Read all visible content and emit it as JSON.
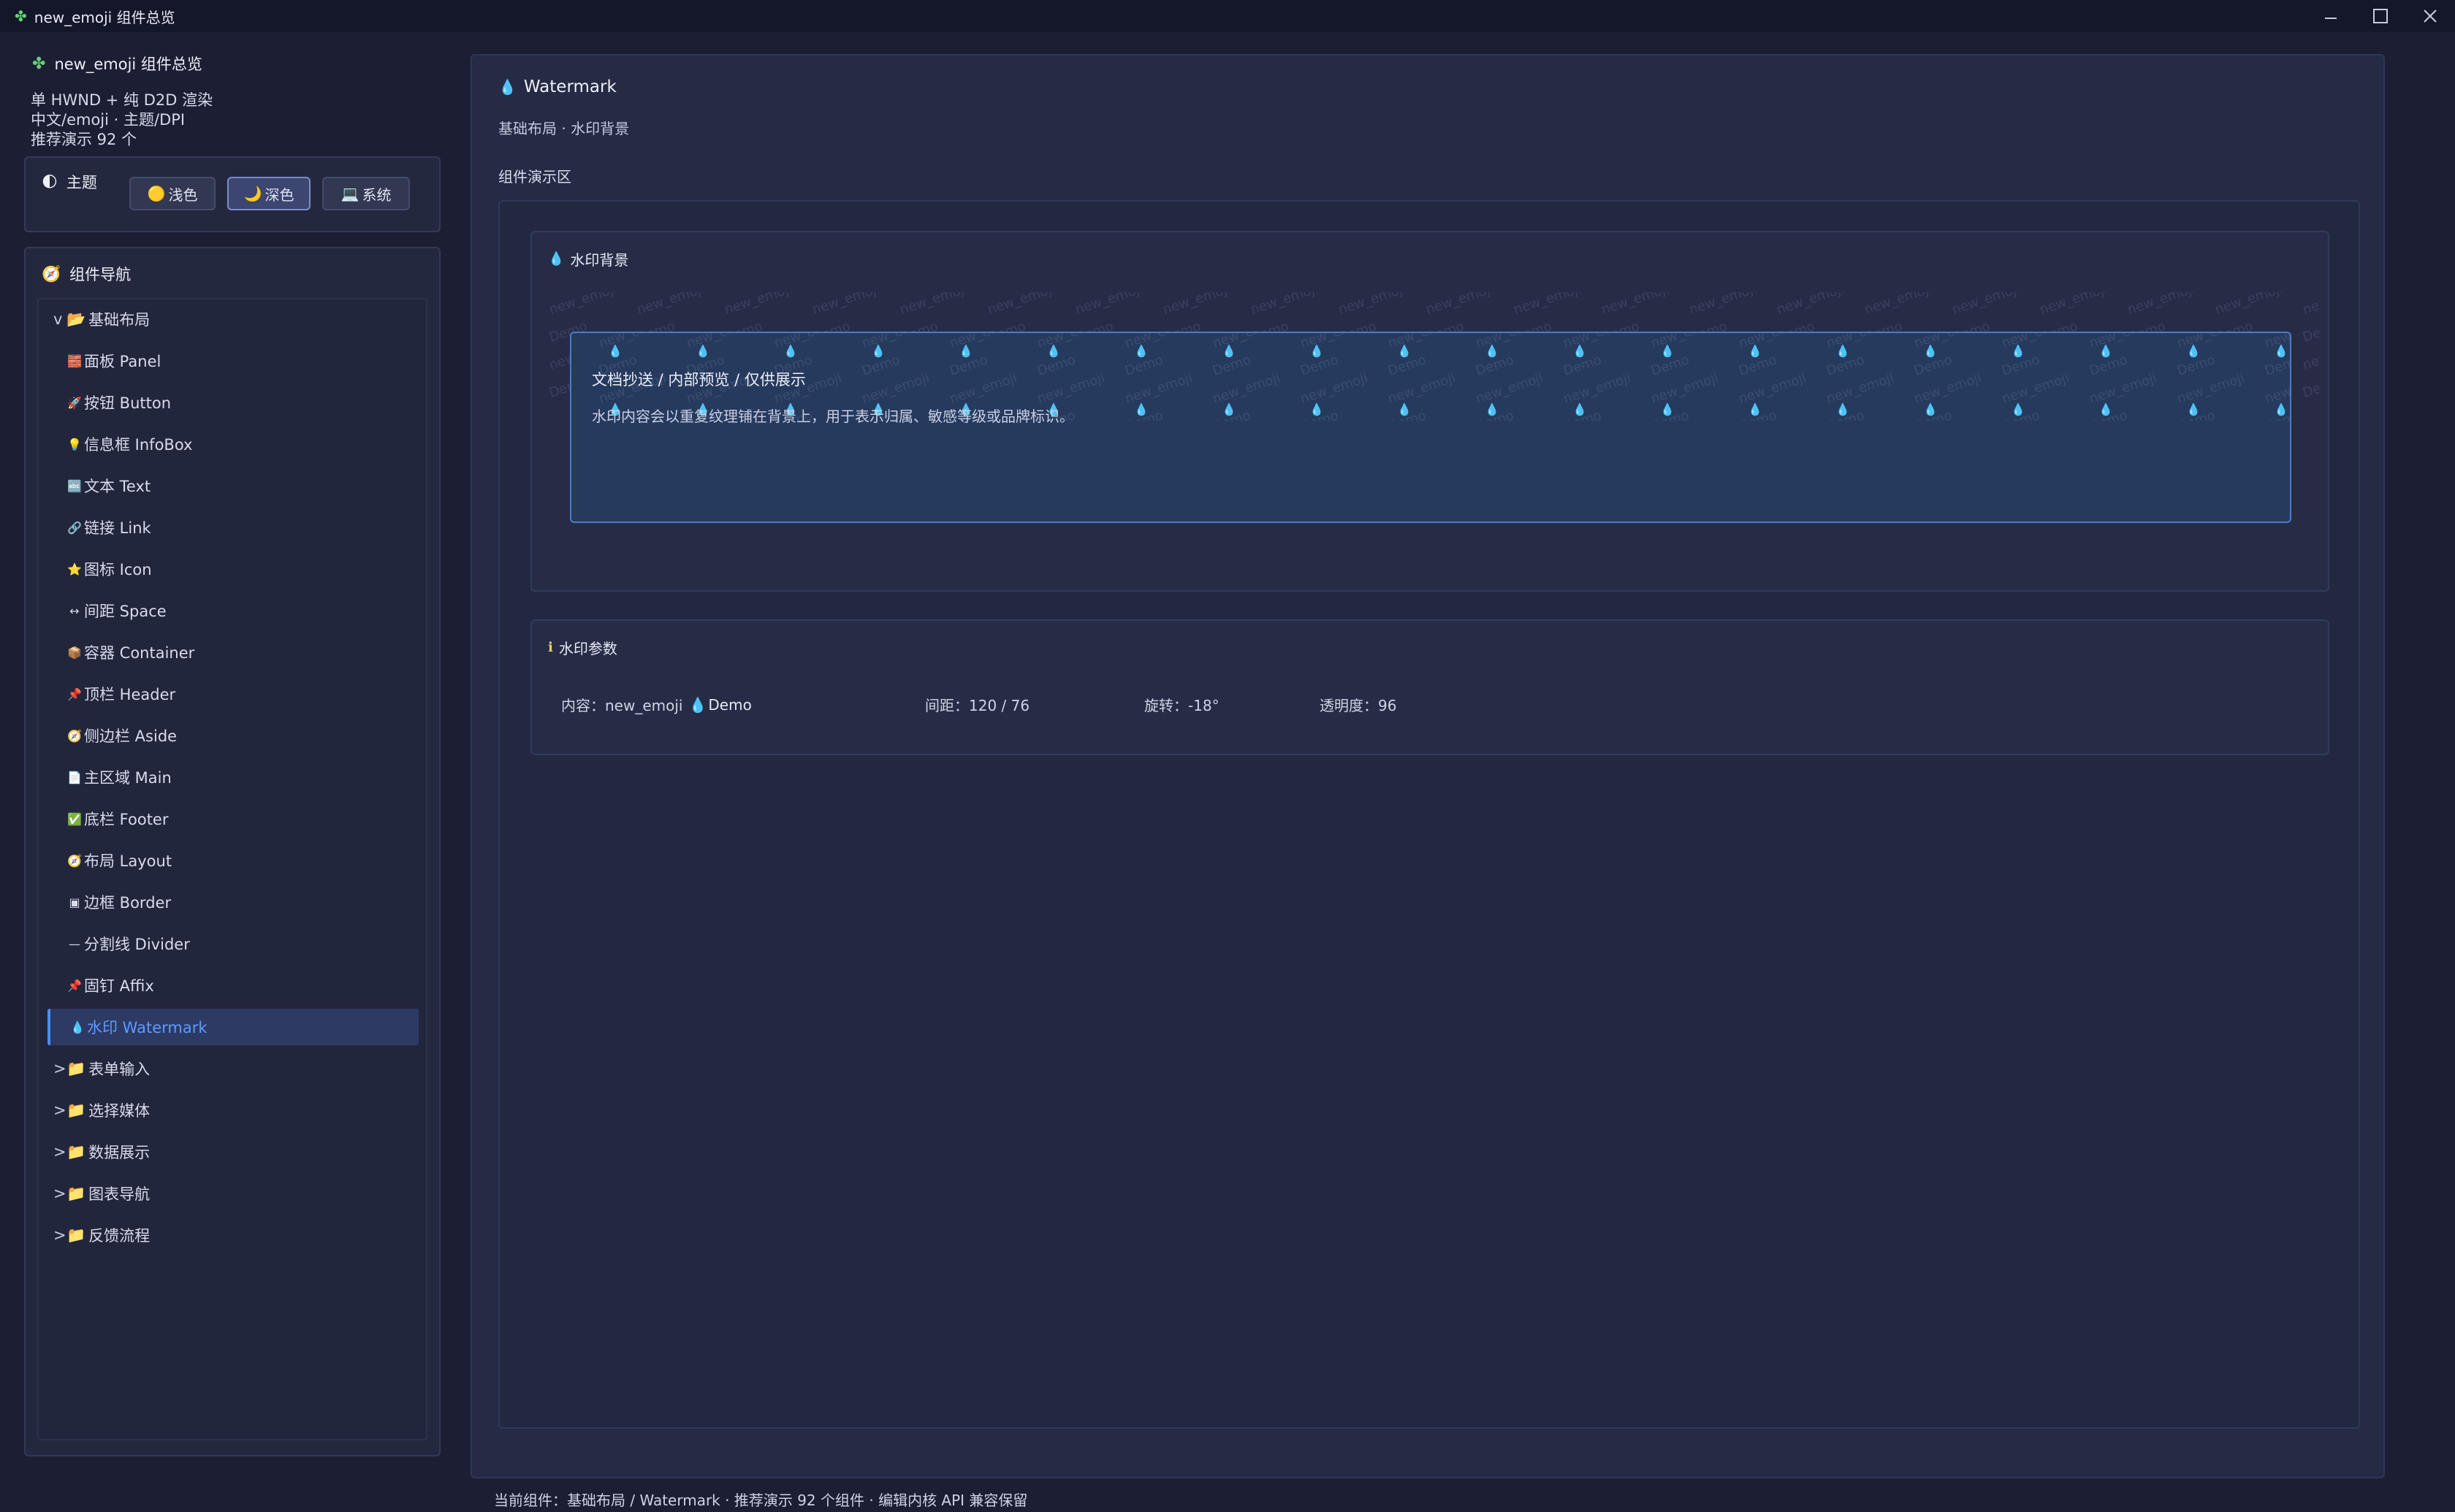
{
  "window": {
    "title": "new_emoji 组件总览",
    "app_icon": "puzzle-icon",
    "controls": [
      "minimize-icon",
      "maximize-icon",
      "close-icon"
    ]
  },
  "sidebar": {
    "app_title": "new_emoji 组件总览",
    "meta": [
      "单 HWND + 纯 D2D 渲染",
      "中文/emoji · 主题/DPI",
      "推荐演示 92 个"
    ],
    "theme": {
      "title": "主题",
      "buttons": [
        {
          "icon": "🟡",
          "label": "浅色",
          "active": false
        },
        {
          "icon": "🌙",
          "label": "深色",
          "active": true
        },
        {
          "icon": "💻",
          "label": "系统",
          "active": false
        }
      ]
    },
    "nav": {
      "title": "组件导航",
      "groups": [
        {
          "caret": "v",
          "icon": "📂",
          "label": "基础布局"
        },
        {
          "caret": ">",
          "icon": "📁",
          "label": "表单输入"
        },
        {
          "caret": ">",
          "icon": "📁",
          "label": "选择媒体"
        },
        {
          "caret": ">",
          "icon": "📁",
          "label": "数据展示"
        },
        {
          "caret": ">",
          "icon": "📁",
          "label": "图表导航"
        },
        {
          "caret": ">",
          "icon": "📁",
          "label": "反馈流程"
        }
      ],
      "items": [
        {
          "icon": "🧱",
          "label": "面板 Panel"
        },
        {
          "icon": "🚀",
          "label": "按钮 Button"
        },
        {
          "icon": "💡",
          "label": "信息框 InfoBox"
        },
        {
          "icon": "🔤",
          "label": "文本 Text"
        },
        {
          "icon": "🔗",
          "label": "链接 Link"
        },
        {
          "icon": "⭐",
          "label": "图标 Icon"
        },
        {
          "icon": "↔",
          "label": "间距 Space"
        },
        {
          "icon": "📦",
          "label": "容器 Container"
        },
        {
          "icon": "📌",
          "label": "顶栏 Header"
        },
        {
          "icon": "🧭",
          "label": "侧边栏 Aside"
        },
        {
          "icon": "📄",
          "label": "主区域 Main"
        },
        {
          "icon": "✅",
          "label": "底栏 Footer"
        },
        {
          "icon": "🧭",
          "label": "布局 Layout"
        },
        {
          "icon": "▣",
          "label": "边框 Border"
        },
        {
          "icon": "—",
          "label": "分割线 Divider"
        },
        {
          "icon": "📌",
          "label": "固钉 Affix"
        },
        {
          "icon": "💧",
          "label": "水印 Watermark"
        }
      ],
      "selected_index": 16
    }
  },
  "main": {
    "title": "Watermark",
    "subtitle": "基础布局 · 水印背景",
    "demo_label": "组件演示区",
    "watermark_card": {
      "title": "水印背景",
      "tile_text_1": "new_emoji",
      "tile_text_2": "Demo",
      "box_heading": "文档抄送 / 内部预览 / 仅供展示",
      "box_body": "水印内容会以重复纹理铺在背景上，用于表示归属、敏感等级或品牌标识。"
    },
    "params_card": {
      "title": "水印参数",
      "content_label": "内容：new_emoji",
      "content_value": "Demo",
      "gap": "间距：120 / 76",
      "rotation": "旋转：-18°",
      "opacity": "透明度：96"
    }
  },
  "status": "当前组件：基础布局 / Watermark · 推荐演示 92 个组件 · 编辑内核 API 兼容保留"
}
